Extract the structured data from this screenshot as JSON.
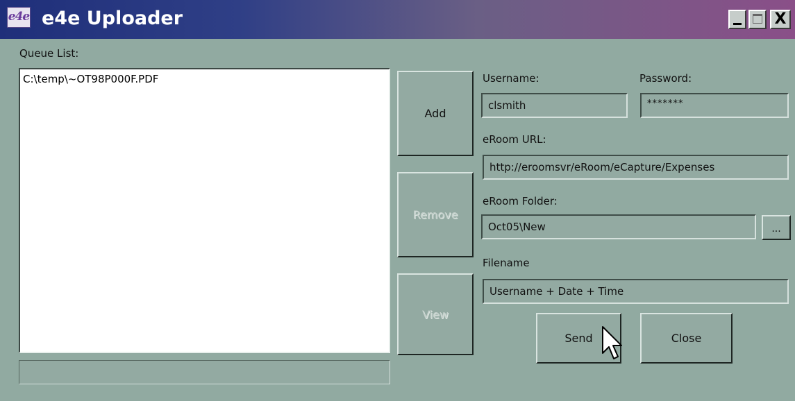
{
  "window": {
    "title": "e4e Uploader",
    "logo_text": "e4e",
    "controls": {
      "minimize_icon": "minimize-icon",
      "maximize_icon": "maximize-icon",
      "close_icon": "close-icon",
      "close_glyph": "X"
    }
  },
  "queue": {
    "label": "Queue List:",
    "items": [
      "C:\\temp\\~OT98P000F.PDF"
    ],
    "status_text": ""
  },
  "actions": {
    "add_label": "Add",
    "remove_label": "Remove",
    "view_label": "View",
    "remove_enabled": false,
    "view_enabled": false
  },
  "form": {
    "username_label": "Username:",
    "username_value": "clsmith",
    "password_label": "Password:",
    "password_value": "*******",
    "url_label": "eRoom URL:",
    "url_value": "http://eroomsvr/eRoom/eCapture/Expenses",
    "folder_label": "eRoom Folder:",
    "folder_value": "Oct05\\New",
    "browse_label": "...",
    "filename_label": "Filename",
    "filename_value": "Username + Date + Time"
  },
  "footer": {
    "send_label": "Send",
    "close_label": "Close"
  },
  "colors": {
    "background": "#91aaa1",
    "titlebar_start": "#1f2f7a",
    "titlebar_end": "#8a4f88",
    "disabled_text": "#c4d0cb"
  }
}
